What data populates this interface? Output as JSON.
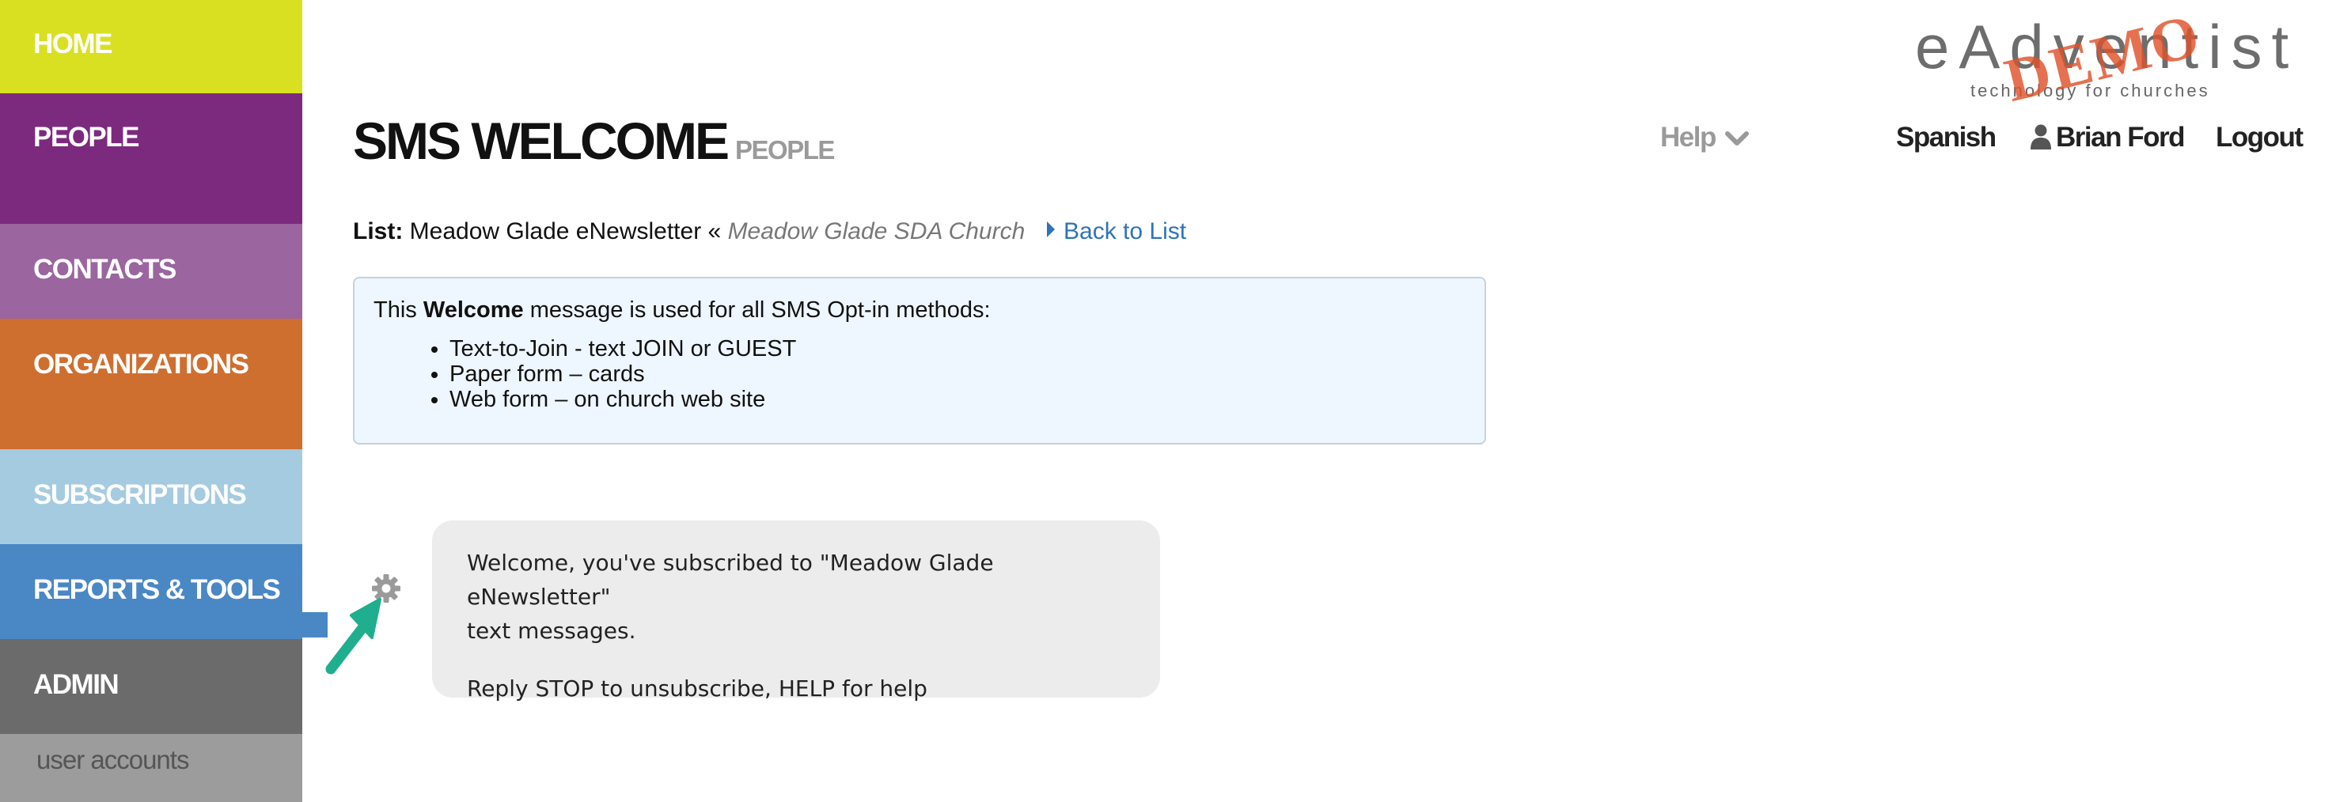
{
  "sidebar": {
    "items": [
      {
        "label": "HOME",
        "color": "#d9e021"
      },
      {
        "label": "PEOPLE",
        "color": "#7b2a7e"
      },
      {
        "label": "CONTACTS",
        "color": "#9b659f"
      },
      {
        "label": "ORGANIZATIONS",
        "color": "#cf6f2f"
      },
      {
        "label": "SUBSCRIPTIONS",
        "color": "#a5cbe0"
      },
      {
        "label": "REPORTS & TOOLS",
        "color": "#4a87c5"
      },
      {
        "label": "ADMIN",
        "color": "#6b6b6b"
      }
    ],
    "sub_item": "user accounts"
  },
  "header": {
    "title": "SMS WELCOME",
    "section": "PEOPLE",
    "help": "Help",
    "language": "Spanish",
    "user": "Brian Ford",
    "logout": "Logout"
  },
  "logo": {
    "name": "eAdventist",
    "tagline": "technology for churches",
    "stamp": "DEMO"
  },
  "list": {
    "label": "List:",
    "name": "Meadow Glade eNewsletter",
    "separator": "«",
    "church": "Meadow Glade SDA Church",
    "back_link": "Back to List"
  },
  "info": {
    "intro_pre": "This ",
    "intro_bold": "Welcome",
    "intro_post": " message is used for all SMS Opt-in methods:",
    "methods": [
      "Text-to-Join - text JOIN or GUEST",
      "Paper form – cards",
      "Web form – on church web site"
    ]
  },
  "sms": {
    "message_line1": "Welcome, you've subscribed to \"Meadow Glade eNewsletter\"",
    "message_line2": "text messages.",
    "footer": "Reply STOP to unsubscribe, HELP for help"
  },
  "icons": {
    "gear": "gear-icon",
    "arrow": "arrow-pointer-icon",
    "user": "user-icon",
    "chevron": "chevron-down-icon",
    "triangle": "caret-right-icon"
  },
  "colors": {
    "link": "#2e73b8",
    "arrow": "#1fae8e",
    "demo_stamp": "#e0532c"
  }
}
